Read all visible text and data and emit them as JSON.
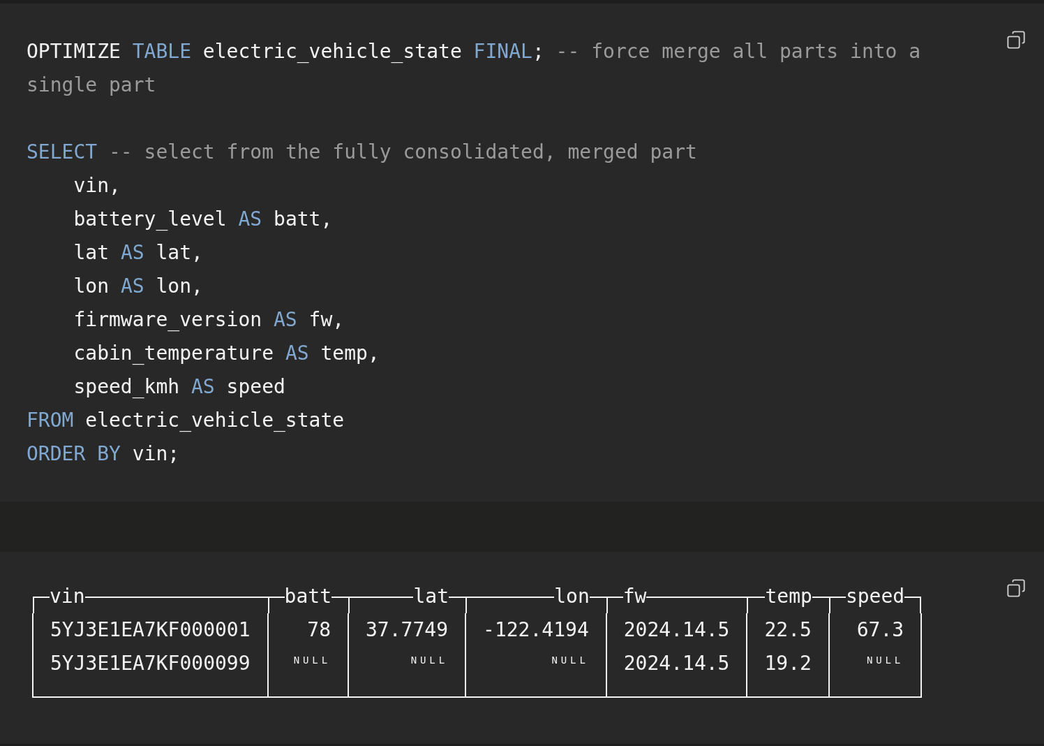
{
  "query_block": {
    "statements": [
      [
        [
          {
            "kind": "plain",
            "text": "OPTIMIZE "
          },
          {
            "kind": "keyword",
            "text": "TABLE"
          },
          {
            "kind": "plain",
            "text": " electric_vehicle_state "
          },
          {
            "kind": "keyword",
            "text": "FINAL"
          },
          {
            "kind": "plain",
            "text": "; "
          },
          {
            "kind": "comment",
            "text": "-- force merge all parts into a single part"
          }
        ]
      ],
      [
        [
          {
            "kind": "keyword",
            "text": "SELECT"
          },
          {
            "kind": "comment",
            "text": " -- select from the fully consolidated, merged part"
          }
        ],
        [
          {
            "kind": "plain",
            "text": "    vin,"
          }
        ],
        [
          {
            "kind": "plain",
            "text": "    battery_level "
          },
          {
            "kind": "keyword",
            "text": "AS"
          },
          {
            "kind": "plain",
            "text": " batt,"
          }
        ],
        [
          {
            "kind": "plain",
            "text": "    lat "
          },
          {
            "kind": "keyword",
            "text": "AS"
          },
          {
            "kind": "plain",
            "text": " lat,"
          }
        ],
        [
          {
            "kind": "plain",
            "text": "    lon "
          },
          {
            "kind": "keyword",
            "text": "AS"
          },
          {
            "kind": "plain",
            "text": " lon,"
          }
        ],
        [
          {
            "kind": "plain",
            "text": "    firmware_version "
          },
          {
            "kind": "keyword",
            "text": "AS"
          },
          {
            "kind": "plain",
            "text": " fw,"
          }
        ],
        [
          {
            "kind": "plain",
            "text": "    cabin_temperature "
          },
          {
            "kind": "keyword",
            "text": "AS"
          },
          {
            "kind": "plain",
            "text": " temp,"
          }
        ],
        [
          {
            "kind": "plain",
            "text": "    speed_kmh "
          },
          {
            "kind": "keyword",
            "text": "AS"
          },
          {
            "kind": "plain",
            "text": " speed"
          }
        ],
        [
          {
            "kind": "keyword",
            "text": "FROM"
          },
          {
            "kind": "plain",
            "text": " electric_vehicle_state"
          }
        ],
        [
          {
            "kind": "keyword",
            "text": "ORDER BY"
          },
          {
            "kind": "plain",
            "text": " vin;"
          }
        ]
      ]
    ]
  },
  "result_block": {
    "columns": [
      {
        "name": "vin",
        "kind": "string"
      },
      {
        "name": "batt",
        "kind": "number"
      },
      {
        "name": "lat",
        "kind": "number"
      },
      {
        "name": "lon",
        "kind": "number"
      },
      {
        "name": "fw",
        "kind": "string"
      },
      {
        "name": "temp",
        "kind": "number"
      },
      {
        "name": "speed",
        "kind": "number"
      }
    ],
    "rows": [
      [
        {
          "kind": "value",
          "text": "5YJ3E1EA7KF000001"
        },
        {
          "kind": "value",
          "text": "78"
        },
        {
          "kind": "value",
          "text": "37.7749"
        },
        {
          "kind": "value",
          "text": "-122.4194"
        },
        {
          "kind": "value",
          "text": "2024.14.5"
        },
        {
          "kind": "value",
          "text": "22.5"
        },
        {
          "kind": "value",
          "text": "67.3"
        }
      ],
      [
        {
          "kind": "value",
          "text": "5YJ3E1EA7KF000099"
        },
        {
          "kind": "null",
          "text": "NULL"
        },
        {
          "kind": "null",
          "text": "NULL"
        },
        {
          "kind": "null",
          "text": "NULL"
        },
        {
          "kind": "value",
          "text": "2024.14.5"
        },
        {
          "kind": "value",
          "text": "19.2"
        },
        {
          "kind": "null",
          "text": "NULL"
        }
      ]
    ]
  }
}
